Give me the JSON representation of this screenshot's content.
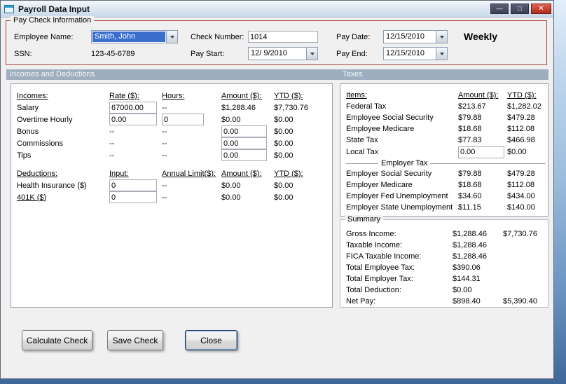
{
  "window": {
    "title": "Payroll Data Input",
    "buttons": {
      "minimize": "—",
      "maximize": "□",
      "close": "✕"
    }
  },
  "colors": {
    "group_border_red": "#a94438",
    "section_header_bg": "#9eaebe",
    "selection_blue": "#3a6fce",
    "close_button_red": "#b02c1d",
    "dialog_bg": "#f0f0f0"
  },
  "paycheck": {
    "legend": "Pay Check Information",
    "employee_name": {
      "label": "Employee Name:",
      "value": "Smith, John"
    },
    "ssn": {
      "label": "SSN:",
      "value": "123-45-6789"
    },
    "check_number": {
      "label": "Check Number:",
      "value": "1014"
    },
    "pay_start": {
      "label": "Pay Start:",
      "value": "12/ 9/2010"
    },
    "pay_date": {
      "label": "Pay Date:",
      "value": "12/15/2010"
    },
    "pay_end": {
      "label": "Pay End:",
      "value": "12/15/2010"
    },
    "frequency": "Weekly"
  },
  "sections": {
    "left": "Incomes and Deductions",
    "right": "Taxes"
  },
  "incomes": {
    "headers": [
      "Incomes:",
      "Rate ($):",
      "Hours:",
      "Amount ($):",
      "YTD ($):"
    ],
    "rows": [
      {
        "label": "Salary",
        "rate": "67000.00",
        "hours": "--",
        "amount": "$1,288.46",
        "ytd": "$7,730.76"
      },
      {
        "label": "Overtime Hourly",
        "rate": "0.00",
        "hours": "0",
        "amount": "$0.00",
        "ytd": "$0.00"
      },
      {
        "label": "Bonus",
        "rate": "--",
        "hours": "--",
        "amount": "0.00",
        "ytd": "$0.00"
      },
      {
        "label": "Commissions",
        "rate": "--",
        "hours": "--",
        "amount": "0.00",
        "ytd": "$0.00"
      },
      {
        "label": "Tips",
        "rate": "--",
        "hours": "--",
        "amount": "0.00",
        "ytd": "$0.00"
      }
    ]
  },
  "deductions": {
    "headers": [
      "Deductions:",
      "Input:",
      "Annual Limit($):",
      "Amount ($):",
      "YTD ($):"
    ],
    "rows": [
      {
        "label": "Health Insurance ($)",
        "input": "0",
        "limit": "--",
        "amount": "$0.00",
        "ytd": "$0.00"
      },
      {
        "label": "401K ($)",
        "input": "0",
        "limit": "--",
        "amount": "$0.00",
        "ytd": "$0.00"
      }
    ]
  },
  "taxes": {
    "headers": [
      "Items:",
      "Amount ($):",
      "YTD ($):"
    ],
    "employee_rows": [
      {
        "label": "Federal Tax",
        "amount": "$213.67",
        "ytd": "$1,282.02"
      },
      {
        "label": "Employee Social Security",
        "amount": "$79.88",
        "ytd": "$479.28"
      },
      {
        "label": "Employee Medicare",
        "amount": "$18.68",
        "ytd": "$112.08"
      },
      {
        "label": "State Tax",
        "amount": "$77.83",
        "ytd": "$466.98"
      },
      {
        "label": "Local Tax",
        "amount": "0.00",
        "ytd": "$0.00"
      }
    ],
    "employer_section_label": "Employer Tax",
    "employer_rows": [
      {
        "label": "Employer Social Security",
        "amount": "$79.88",
        "ytd": "$479.28"
      },
      {
        "label": "Employer Medicare",
        "amount": "$18.68",
        "ytd": "$112.08"
      },
      {
        "label": "Employer Fed Unemployment",
        "amount": "$34.60",
        "ytd": "$434.00"
      },
      {
        "label": "Employer State Unemployment",
        "amount": "$11.15",
        "ytd": "$140.00"
      }
    ]
  },
  "summary": {
    "legend": "Summary",
    "rows": [
      {
        "label": "Gross Income:",
        "amount": "$1,288.46",
        "ytd": "$7,730.76"
      },
      {
        "label": "Taxable Income:",
        "amount": "$1,288.46",
        "ytd": ""
      },
      {
        "label": "FICA Taxable Income:",
        "amount": "$1,288.46",
        "ytd": ""
      },
      {
        "label": "Total Employee Tax:",
        "amount": "$390.06",
        "ytd": ""
      },
      {
        "label": "Total Employer Tax:",
        "amount": "$144.31",
        "ytd": ""
      },
      {
        "label": "Total Deduction:",
        "amount": "$0.00",
        "ytd": ""
      },
      {
        "label": "Net Pay:",
        "amount": "$898.40",
        "ytd": "$5,390.40"
      }
    ]
  },
  "actions": {
    "calculate": "Calculate Check",
    "save": "Save Check",
    "close": "Close"
  }
}
